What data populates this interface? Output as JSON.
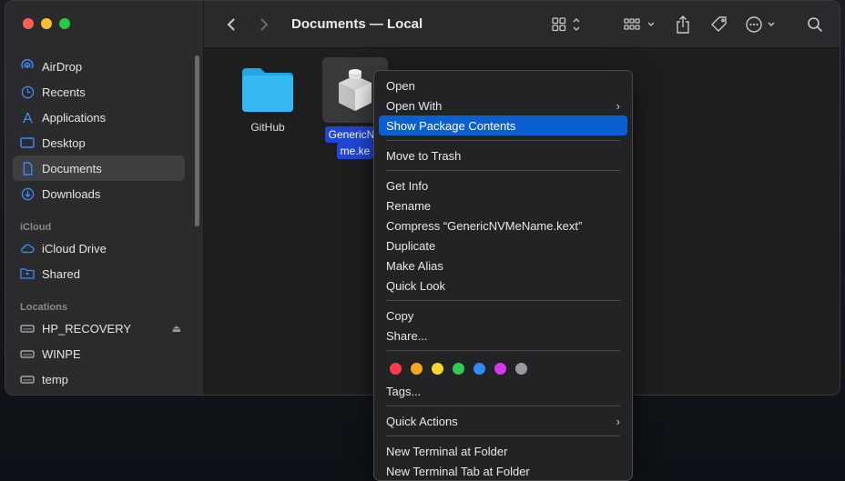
{
  "window": {
    "title": "Documents — Local"
  },
  "sidebar": {
    "favorites": [
      {
        "label": "AirDrop",
        "icon": "airdrop-icon"
      },
      {
        "label": "Recents",
        "icon": "clock-icon"
      },
      {
        "label": "Applications",
        "icon": "applications-icon"
      },
      {
        "label": "Desktop",
        "icon": "desktop-icon"
      },
      {
        "label": "Documents",
        "icon": "document-icon",
        "selected": true
      },
      {
        "label": "Downloads",
        "icon": "download-icon"
      }
    ],
    "icloud_header": "iCloud",
    "icloud": [
      {
        "label": "iCloud Drive",
        "icon": "cloud-icon"
      },
      {
        "label": "Shared",
        "icon": "shared-folder-icon"
      }
    ],
    "locations_header": "Locations",
    "locations": [
      {
        "label": "HP_RECOVERY",
        "icon": "drive-icon",
        "eject": "⏏"
      },
      {
        "label": "WINPE",
        "icon": "drive-icon"
      },
      {
        "label": "temp",
        "icon": "drive-icon"
      }
    ]
  },
  "files": [
    {
      "name": "GitHub",
      "icon": "folder-icon"
    },
    {
      "name_line1": "GenericNV",
      "name_line2": "me.ke",
      "icon": "kext-bundle-icon"
    }
  ],
  "context_menu": {
    "open": "Open",
    "open_with": "Open With",
    "show_package_contents": "Show Package Contents",
    "move_to_trash": "Move to Trash",
    "get_info": "Get Info",
    "rename": "Rename",
    "compress": "Compress “GenericNVMeName.kext”",
    "duplicate": "Duplicate",
    "make_alias": "Make Alias",
    "quick_look": "Quick Look",
    "copy": "Copy",
    "share": "Share...",
    "tags": "Tags...",
    "quick_actions": "Quick Actions",
    "new_terminal": "New Terminal at Folder",
    "new_terminal_tab": "New Terminal Tab at Folder",
    "tag_colors": [
      "#ff3b4e",
      "#f5a623",
      "#f8d631",
      "#2ecc51",
      "#2f8cf5",
      "#d63af0",
      "#9a9a9e"
    ]
  },
  "accent": "#0a5fd3"
}
